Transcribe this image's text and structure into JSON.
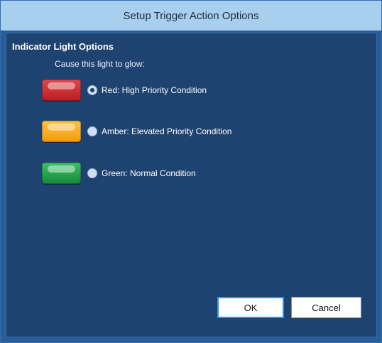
{
  "window": {
    "title": "Setup Trigger Action Options"
  },
  "group": {
    "title": "Indicator Light Options",
    "cause_label": "Cause this light to glow:"
  },
  "options": [
    {
      "label": "Red: High Priority Condition",
      "checked": true,
      "color": "#c8272c"
    },
    {
      "label": "Amber: Elevated Priority Condition",
      "checked": false,
      "color": "#f4a51a"
    },
    {
      "label": "Green: Normal Condition",
      "checked": false,
      "color": "#1f9a43"
    }
  ],
  "buttons": {
    "ok_label": "OK",
    "cancel_label": "Cancel"
  },
  "colors": {
    "titlebar": "#a9cfee",
    "client_background": "#1f4370",
    "frame": "#2a5d96"
  }
}
